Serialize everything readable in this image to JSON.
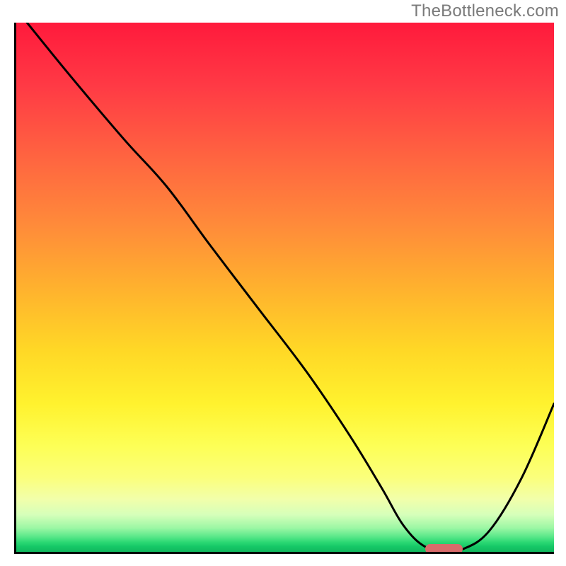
{
  "watermark": "TheBottleneck.com",
  "chart_data": {
    "type": "line",
    "title": "",
    "xlabel": "",
    "ylabel": "",
    "xlim": [
      0,
      100
    ],
    "ylim": [
      0,
      100
    ],
    "grid": false,
    "legend": false,
    "series": [
      {
        "name": "bottleneck-curve",
        "x": [
          2,
          10,
          20,
          28,
          36,
          45,
          54,
          62,
          68,
          72,
          76,
          80,
          83,
          88,
          94,
          100
        ],
        "values": [
          100,
          90,
          78,
          69,
          58,
          46,
          34,
          22,
          12,
          5,
          1,
          0.5,
          0.5,
          4,
          14,
          28
        ]
      }
    ],
    "marker": {
      "name": "optimal-range",
      "x_start": 76,
      "x_end": 83,
      "y": 0.5,
      "color": "#d96b6b"
    },
    "background_gradient": {
      "top": "#ff1a3c",
      "mid_upper": "#ffb12e",
      "mid_lower": "#fdff56",
      "bottom": "#11b75e"
    }
  }
}
